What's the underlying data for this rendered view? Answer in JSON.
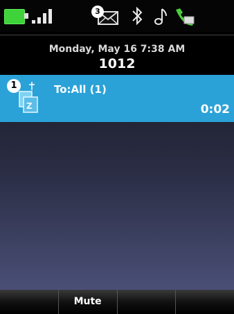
{
  "status_bar": {
    "battery_icon": "battery-icon",
    "signal_icon": "signal-strength-icon",
    "message_badge": "3",
    "message_icon": "envelope-icon",
    "bluetooth_icon": "bluetooth-icon",
    "ringer_icon": "music-note-icon",
    "call_icon": "phone-handset-icon",
    "battery_color": "#3fd23a"
  },
  "header": {
    "date_time": "Monday, May 16 7:38 AM",
    "extension": "1012"
  },
  "calls": [
    {
      "line_number": "1",
      "label": "To:All (1)",
      "timer": "0:02",
      "icon": "paging-call-icon"
    }
  ],
  "softkeys": [
    "",
    "Mute",
    "",
    ""
  ],
  "colors": {
    "call_highlight": "#2aa2d8",
    "background_top": "#1d1f2c",
    "background_bottom": "#4a4f76"
  }
}
